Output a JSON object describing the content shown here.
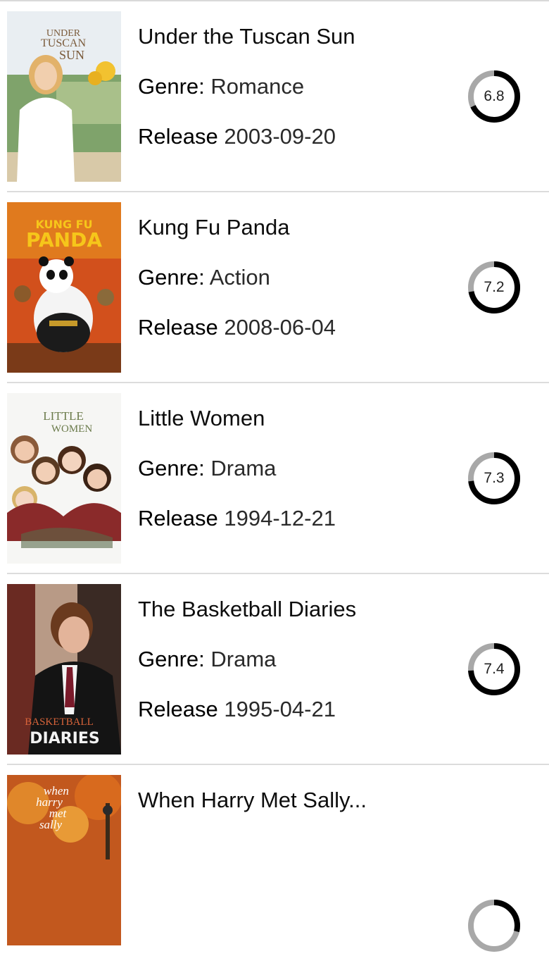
{
  "movies": [
    {
      "title": "Under the Tuscan Sun",
      "genre_label": "Genre:",
      "genre": "Romance",
      "release_label": "Release",
      "release": "2003-09-20",
      "rating": "6.8",
      "poster_text": "UNDER TUSCAN SUN"
    },
    {
      "title": "Kung Fu Panda",
      "genre_label": "Genre:",
      "genre": "Action",
      "release_label": "Release",
      "release": "2008-06-04",
      "rating": "7.2",
      "poster_text": "KUNG FU PANDA"
    },
    {
      "title": "Little Women",
      "genre_label": "Genre:",
      "genre": "Drama",
      "release_label": "Release",
      "release": "1994-12-21",
      "rating": "7.3",
      "poster_text": "LITTLE WOMEN"
    },
    {
      "title": "The Basketball Diaries",
      "genre_label": "Genre:",
      "genre": "Drama",
      "release_label": "Release",
      "release": "1995-04-21",
      "rating": "7.4",
      "poster_text": "BASKETBALL DIARIES"
    },
    {
      "title": "When Harry Met Sally...",
      "poster_text": "when harry met sally"
    }
  ],
  "colors": {
    "ring_track": "#a8a8a8",
    "ring_fill": "#000000"
  }
}
